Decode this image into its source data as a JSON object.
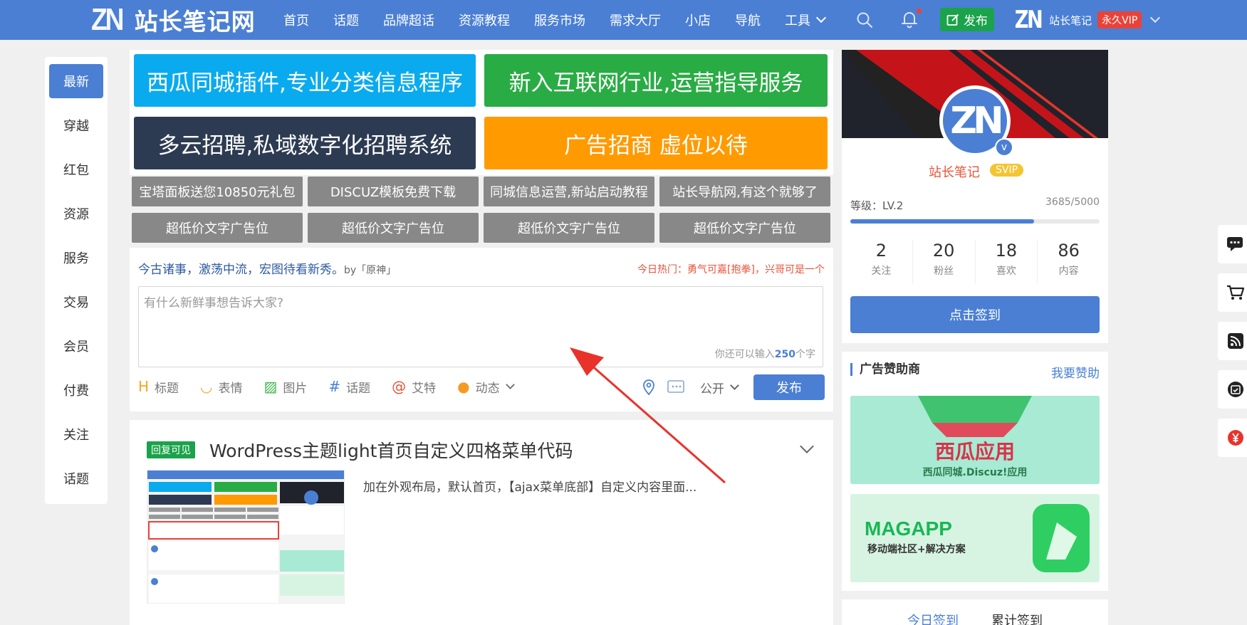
{
  "header": {
    "logo_mark": "ZN",
    "logo_text": "站长笔记网",
    "nav": [
      "首页",
      "话题",
      "品牌超话",
      "资源教程",
      "服务市场",
      "需求大厅",
      "小店",
      "导航",
      "工具"
    ],
    "publish": "发布",
    "user_mark": "ZN",
    "user_name": "站长笔记",
    "vip": "永久VIP"
  },
  "left_nav": [
    "最新",
    "穿越",
    "红包",
    "资源",
    "服务",
    "交易",
    "会员",
    "付费",
    "关注",
    "话题"
  ],
  "big_ads": [
    {
      "text": "西瓜同城插件,专业分类信息程序",
      "color": "#0aabee"
    },
    {
      "text": "新入互联网行业,运营指导服务",
      "color": "#2aac45"
    },
    {
      "text": "多云招聘,私域数字化招聘系统",
      "color": "#2d3b52"
    },
    {
      "text": "广告招商 虚位以待",
      "color": "#ff9a00"
    }
  ],
  "text_ads": [
    "宝塔面板送您10850元礼包",
    "DISCUZ模板免费下载",
    "同城信息运营,新站启动教程",
    "站长导航网,有这个就够了",
    "超低价文字广告位",
    "超低价文字广告位",
    "超低价文字广告位",
    "超低价文字广告位"
  ],
  "post": {
    "motto": "今古诸事，激荡中流，宏图待看新秀。",
    "motto_by": "by「原神」",
    "hot": "今日热门：勇气可嘉[抱拳]，兴哥可是一个",
    "placeholder": "有什么新鲜事想告诉大家?",
    "count_prefix": "你还可以输入",
    "count_num": "250",
    "count_suffix": "个字",
    "tools": [
      {
        "icon": "H",
        "label": "标题",
        "color": "#f5a623"
      },
      {
        "icon": "◡",
        "label": "表情",
        "color": "#f5a623"
      },
      {
        "icon": "▨",
        "label": "图片",
        "color": "#3bb54a"
      },
      {
        "icon": "#",
        "label": "话题",
        "color": "#4a7fd4"
      },
      {
        "icon": "@",
        "label": "艾特",
        "color": "#e8533a"
      },
      {
        "icon": "●",
        "label": "动态",
        "color": "#f59a23"
      }
    ],
    "visibility": "公开",
    "submit": "发布"
  },
  "article": {
    "badge": "回复可见",
    "title": "WordPress主题light首页自定义四格菜单代码",
    "excerpt": "加在外观布局，默认首页，【ajax菜单底部】自定义内容里面..."
  },
  "profile": {
    "avatar": "ZN",
    "verify": "v",
    "name": "站长笔记",
    "badge": "SVIP",
    "level": "等级：LV.2",
    "exp": "3685/5000",
    "progress": 0.737,
    "stats": [
      {
        "n": "2",
        "l": "关注"
      },
      {
        "n": "20",
        "l": "粉丝"
      },
      {
        "n": "18",
        "l": "喜欢"
      },
      {
        "n": "86",
        "l": "内容"
      }
    ],
    "signin": "点击签到"
  },
  "sponsor": {
    "title": "广告赞助商",
    "link": "我要赞助",
    "ad1_title": "西瓜应用",
    "ad1_sub": "西瓜同城.Discuz!应用",
    "ad2_title": "MAGAPP",
    "ad2_sub": "移动端社区+解决方案"
  },
  "checkin": [
    "今日签到",
    "累计签到"
  ],
  "colors": {
    "primary": "#4a7fd4",
    "green": "#1aa34a",
    "red": "#e8433a",
    "orange": "#ff9a00"
  }
}
